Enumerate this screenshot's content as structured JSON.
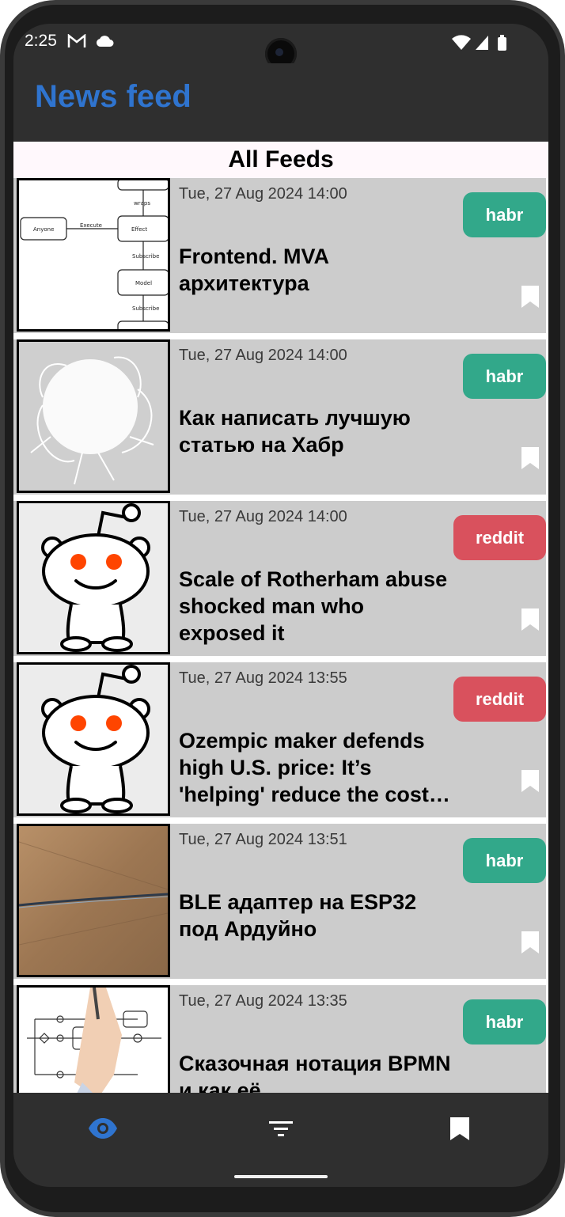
{
  "status": {
    "time": "2:25"
  },
  "app": {
    "title": "News feed",
    "section_title": "All Feeds"
  },
  "colors": {
    "accent": "#2f74cf",
    "habr": "#32a88a",
    "reddit": "#d9515d",
    "card_bg": "#cccccc"
  },
  "articles": [
    {
      "date": "Tue, 27 Aug 2024 14:00",
      "title": "Frontend. MVA архитектура",
      "source": "habr"
    },
    {
      "date": "Tue, 27 Aug 2024 14:00",
      "title": "Как написать лучшую статью на Хабр",
      "source": "habr"
    },
    {
      "date": "Tue, 27 Aug 2024 14:00",
      "title": "Scale of Rotherham abuse shocked man who exposed it",
      "source": "reddit"
    },
    {
      "date": "Tue, 27 Aug 2024 13:55",
      "title": "Ozempic maker defends high U.S. price: It’s 'helping' reduce the cost of weight-loss drugs",
      "source": "reddit"
    },
    {
      "date": "Tue, 27 Aug 2024 13:51",
      "title": "BLE адаптер на ESP32 под Ардуйно",
      "source": "habr"
    },
    {
      "date": "Tue, 27 Aug 2024 13:35",
      "title": "Сказочная нотация BPMN и как её",
      "source": "habr"
    }
  ],
  "bottom_nav": [
    {
      "icon": "eye-icon",
      "active": true
    },
    {
      "icon": "filter-icon",
      "active": false
    },
    {
      "icon": "bookmark-icon",
      "active": false
    }
  ]
}
